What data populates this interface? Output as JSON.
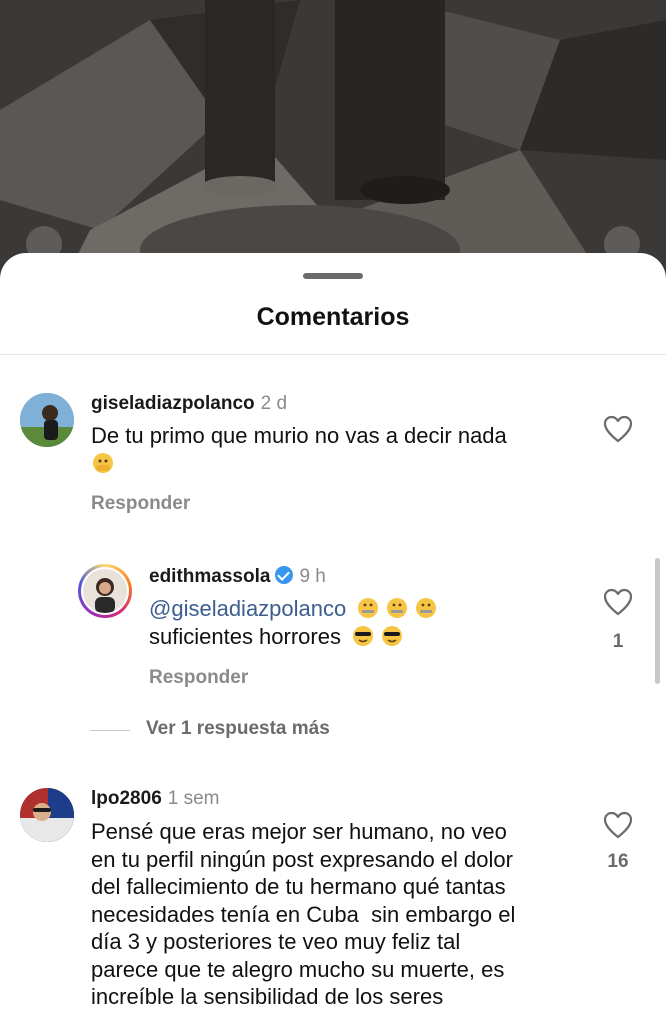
{
  "sheet": {
    "title": "Comentarios"
  },
  "comments": [
    {
      "username": "giseladiazpolanco",
      "time": "2 d",
      "text": "De tu primo que murio no vas a decir nada",
      "emoji": [
        "face-with-hand-over-mouth-emoji"
      ],
      "reply_label": "Responder",
      "likes": ""
    },
    {
      "username": "edithmassola",
      "verified": true,
      "time": "9 h",
      "mention": "@giseladiazpolanco",
      "text": "suficientes horrores",
      "emoji_line1": [
        "zipper-mouth-face-emoji",
        "zipper-mouth-face-emoji",
        "zipper-mouth-face-emoji"
      ],
      "emoji_line2": [
        "smiling-face-with-sunglasses-emoji",
        "smiling-face-with-sunglasses-emoji"
      ],
      "reply_label": "Responder",
      "likes": "1"
    },
    {
      "username": "lpo2806",
      "time": "1 sem",
      "lines": [
        "Pensé que eras mejor ser humano, no veo",
        "en tu perfil ningún post expresando el dolor",
        "del fallecimiento de tu hermano qué tantas",
        "necesidades tenía en Cuba  sin embargo el",
        "día 3 y posteriores te veo muy feliz tal",
        "parece que te alegro mucho su muerte, es",
        "increíble la sensibilidad de los seres"
      ],
      "likes": "16"
    }
  ],
  "more_replies": "Ver 1 respuesta más",
  "icons": {
    "like": "heart-outline-icon",
    "verified": "verified-badge-icon"
  },
  "colors": {
    "mention": "#3c5e8f",
    "secondary_text": "#8a8a8a",
    "verified": "#3797f0"
  }
}
